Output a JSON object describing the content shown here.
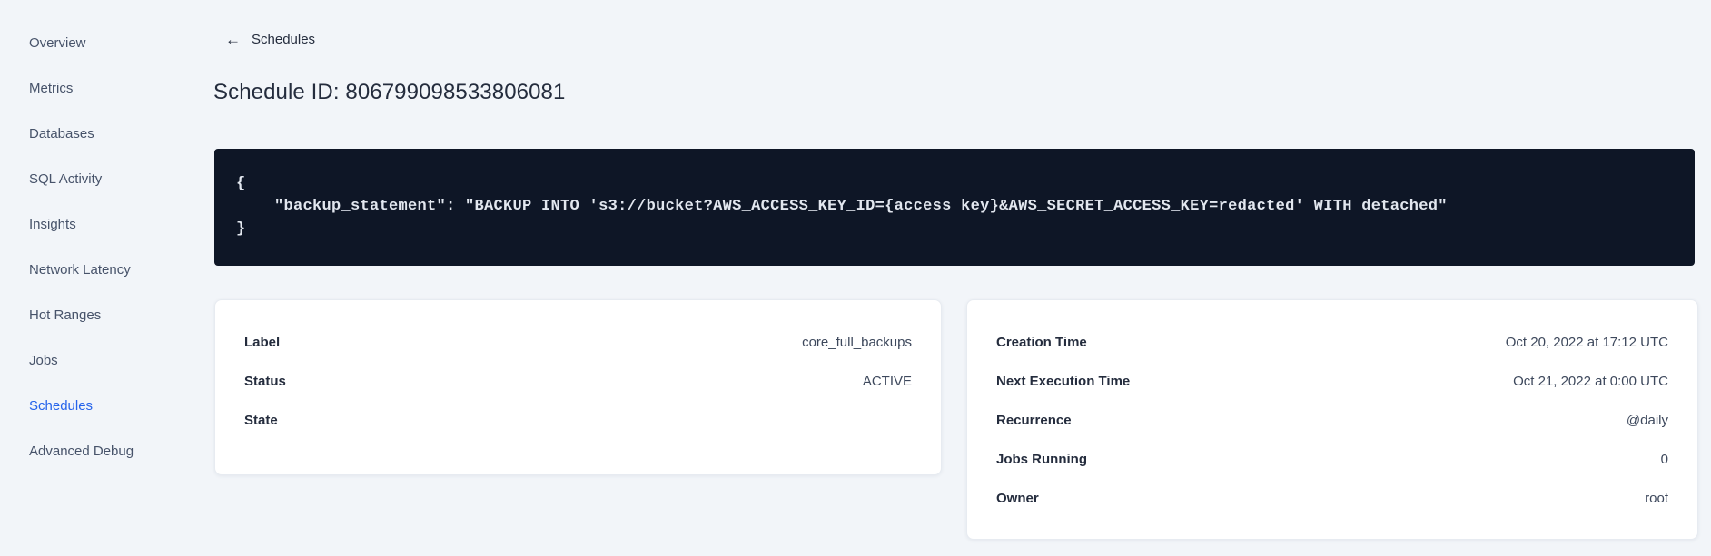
{
  "sidebar": {
    "items": [
      {
        "label": "Overview",
        "active": false
      },
      {
        "label": "Metrics",
        "active": false
      },
      {
        "label": "Databases",
        "active": false
      },
      {
        "label": "SQL Activity",
        "active": false
      },
      {
        "label": "Insights",
        "active": false
      },
      {
        "label": "Network Latency",
        "active": false
      },
      {
        "label": "Hot Ranges",
        "active": false
      },
      {
        "label": "Jobs",
        "active": false
      },
      {
        "label": "Schedules",
        "active": true
      },
      {
        "label": "Advanced Debug",
        "active": false
      }
    ]
  },
  "header": {
    "back_icon": "←",
    "back_label": "Schedules",
    "title": "Schedule ID: 806799098533806081"
  },
  "code_block": {
    "line1": "{",
    "line2": "    \"backup_statement\": \"BACKUP INTO 's3://bucket?AWS_ACCESS_KEY_ID={access key}&AWS_SECRET_ACCESS_KEY=redacted' WITH detached\"",
    "line3": "}"
  },
  "cards": {
    "left": {
      "rows": [
        {
          "label": "Label",
          "value": "core_full_backups"
        },
        {
          "label": "Status",
          "value": "ACTIVE"
        },
        {
          "label": "State",
          "value": ""
        }
      ]
    },
    "right": {
      "rows": [
        {
          "label": "Creation Time",
          "value": "Oct 20, 2022 at 17:12 UTC"
        },
        {
          "label": "Next Execution Time",
          "value": "Oct 21, 2022 at 0:00 UTC"
        },
        {
          "label": "Recurrence",
          "value": "@daily"
        },
        {
          "label": "Jobs Running",
          "value": "0"
        },
        {
          "label": "Owner",
          "value": "root"
        }
      ]
    }
  },
  "colors": {
    "page_background": "#f2f5f9",
    "accent_active_link": "#2563eb",
    "code_background": "#0e1626",
    "code_text": "#e2e7ef",
    "heading_text": "#242c3d",
    "nav_text": "#47536a",
    "value_text": "#3d485c"
  }
}
